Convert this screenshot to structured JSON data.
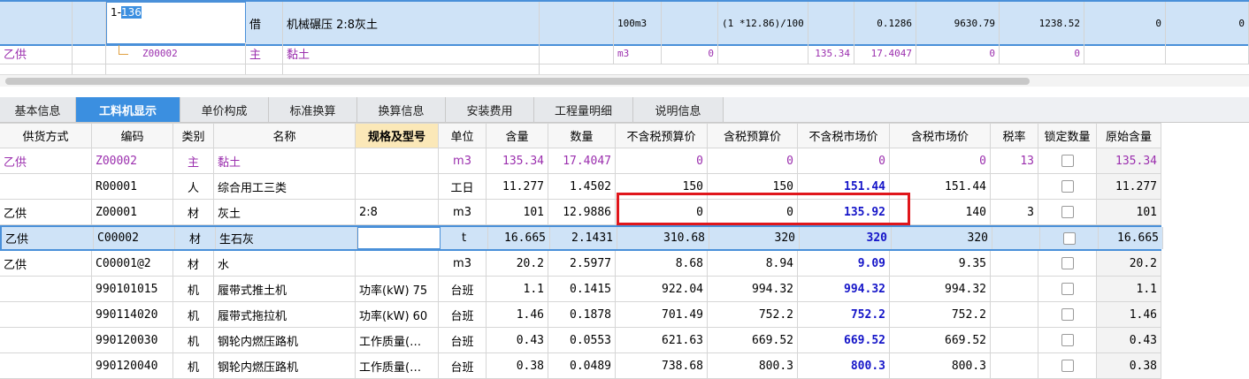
{
  "upper": {
    "row1": {
      "code": "1-136",
      "code_prefix": "1-",
      "code_highlight": "136",
      "type": "借",
      "name": "机械碾压 2:8灰土",
      "unit": "100m3",
      "expr": "(1 *12.86)/100",
      "qty": "0.1286",
      "price": "9630.79",
      "total": "1238.52",
      "v1": "0",
      "v2": "0"
    },
    "row2": {
      "supply": "乙供",
      "code": "Z00002",
      "type": "主",
      "name": "黏土",
      "unit": "m3",
      "v0": "0",
      "content": "135.34",
      "qty": "17.4047",
      "v1": "0",
      "v2": "0"
    }
  },
  "tabs": [
    "基本信息",
    "工料机显示",
    "单价构成",
    "标准换算",
    "换算信息",
    "安装费用",
    "工程量明细",
    "说明信息"
  ],
  "headers": [
    "供货方式",
    "编码",
    "类别",
    "名称",
    "规格及型号",
    "单位",
    "含量",
    "数量",
    "不含税预算价",
    "含税预算价",
    "不含税市场价",
    "含税市场价",
    "税率",
    "锁定数量",
    "原始含量"
  ],
  "rows": [
    {
      "supply": "乙供",
      "code": "Z00002",
      "cat": "主",
      "name": "黏土",
      "spec": "",
      "unit": "m3",
      "content": "135.34",
      "qty": "17.4047",
      "pre_ex": "0",
      "pre_in": "0",
      "mkt_ex": "0",
      "mkt_in": "0",
      "tax": "13",
      "orig": "135.34",
      "purple": true
    },
    {
      "supply": "",
      "code": "R00001",
      "cat": "人",
      "name": "综合用工三类",
      "spec": "",
      "unit": "工日",
      "content": "11.277",
      "qty": "1.4502",
      "pre_ex": "150",
      "pre_in": "150",
      "mkt_ex": "151.44",
      "mkt_in": "151.44",
      "tax": "",
      "orig": "11.277"
    },
    {
      "supply": "乙供",
      "code": "Z00001",
      "cat": "材",
      "name": "灰土",
      "spec": "2:8",
      "unit": "m3",
      "content": "101",
      "qty": "12.9886",
      "pre_ex": "0",
      "pre_in": "0",
      "mkt_ex": "135.92",
      "mkt_in": "140",
      "tax": "3",
      "orig": "101"
    },
    {
      "supply": "乙供",
      "code": "C00002",
      "cat": "材",
      "name": "生石灰",
      "spec": "",
      "unit": "t",
      "content": "16.665",
      "qty": "2.1431",
      "pre_ex": "310.68",
      "pre_in": "320",
      "mkt_ex": "320",
      "mkt_in": "320",
      "tax": "",
      "orig": "16.665",
      "selected": true
    },
    {
      "supply": "乙供",
      "code": "C00001@2",
      "cat": "材",
      "name": "水",
      "spec": "",
      "unit": "m3",
      "content": "20.2",
      "qty": "2.5977",
      "pre_ex": "8.68",
      "pre_in": "8.94",
      "mkt_ex": "9.09",
      "mkt_in": "9.35",
      "tax": "",
      "orig": "20.2"
    },
    {
      "supply": "",
      "code": "990101015",
      "cat": "机",
      "name": "履带式推土机",
      "spec": "功率(kW) 75",
      "unit": "台班",
      "content": "1.1",
      "qty": "0.1415",
      "pre_ex": "922.04",
      "pre_in": "994.32",
      "mkt_ex": "994.32",
      "mkt_in": "994.32",
      "tax": "",
      "orig": "1.1"
    },
    {
      "supply": "",
      "code": "990114020",
      "cat": "机",
      "name": "履带式拖拉机",
      "spec": "功率(kW) 60",
      "unit": "台班",
      "content": "1.46",
      "qty": "0.1878",
      "pre_ex": "701.49",
      "pre_in": "752.2",
      "mkt_ex": "752.2",
      "mkt_in": "752.2",
      "tax": "",
      "orig": "1.46"
    },
    {
      "supply": "",
      "code": "990120030",
      "cat": "机",
      "name": "钢轮内燃压路机",
      "spec": "工作质量(…",
      "unit": "台班",
      "content": "0.43",
      "qty": "0.0553",
      "pre_ex": "621.63",
      "pre_in": "669.52",
      "mkt_ex": "669.52",
      "mkt_in": "669.52",
      "tax": "",
      "orig": "0.43"
    },
    {
      "supply": "",
      "code": "990120040",
      "cat": "机",
      "name": "钢轮内燃压路机",
      "spec": "工作质量(…",
      "unit": "台班",
      "content": "0.38",
      "qty": "0.0489",
      "pre_ex": "738.68",
      "pre_in": "800.3",
      "mkt_ex": "800.3",
      "mkt_in": "800.3",
      "tax": "",
      "orig": "0.38"
    }
  ]
}
